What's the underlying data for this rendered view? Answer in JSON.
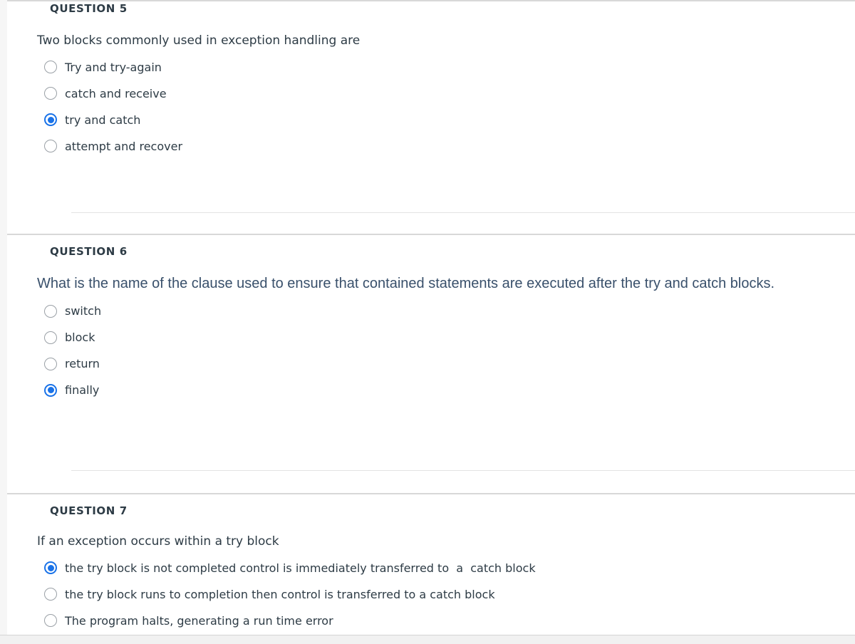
{
  "quiz": {
    "questions": [
      {
        "id": "q5",
        "header": "QUESTION 5",
        "stem": "Two blocks commonly used in exception handling are",
        "options": [
          {
            "label": "Try and try-again",
            "selected": false
          },
          {
            "label": "catch and receive",
            "selected": false
          },
          {
            "label": "try and catch",
            "selected": true
          },
          {
            "label": "attempt and recover",
            "selected": false
          }
        ]
      },
      {
        "id": "q6",
        "header": "QUESTION 6",
        "stem": "What is the name of the clause used to ensure that contained statements are executed after the try and catch blocks.",
        "options": [
          {
            "label": "switch",
            "selected": false
          },
          {
            "label": "block",
            "selected": false
          },
          {
            "label": "return",
            "selected": false
          },
          {
            "label": "finally",
            "selected": true
          }
        ]
      },
      {
        "id": "q7",
        "header": "QUESTION 7",
        "stem": "If an exception occurs within a try block",
        "options": [
          {
            "label": "the try block is not completed control is immediately transferred to  a  catch block",
            "selected": true
          },
          {
            "label": "the try block runs to completion then control is transferred to a catch block",
            "selected": false
          },
          {
            "label": "The program halts, generating a run time error",
            "selected": false
          }
        ]
      }
    ]
  },
  "colors": {
    "accent": "#1972e8",
    "text": "#2d3b45",
    "stem_alt_text": "#39506b",
    "divider": "#d8d8d8",
    "inner_divider": "#e3e3e3",
    "page_gutter": "#f6f6f6",
    "scrollbar_track": "#f1f1f1"
  }
}
